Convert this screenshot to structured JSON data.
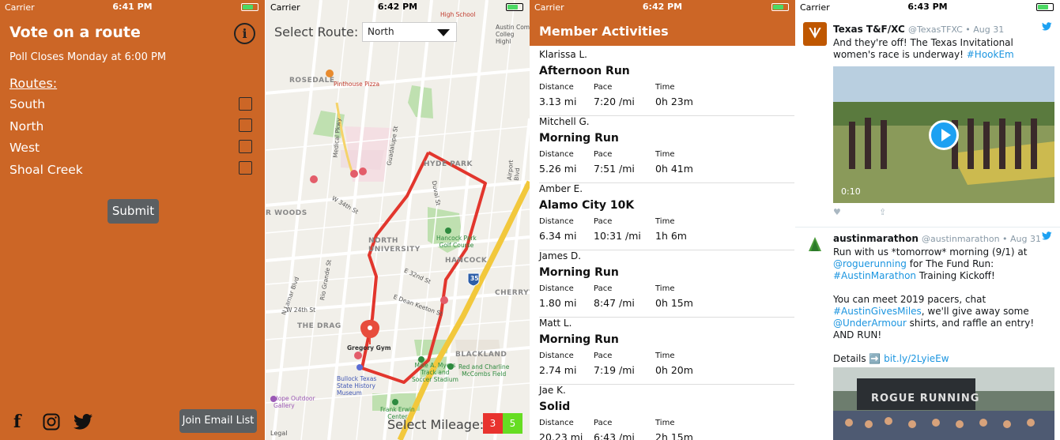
{
  "screens": {
    "vote": {
      "status": {
        "carrier": "Carrier",
        "time": "6:41 PM"
      },
      "title": "Vote on a route",
      "info_icon": "info-icon",
      "poll": "Poll Closes Monday at 6:00 PM",
      "routes_heading": "Routes:",
      "routes": [
        "South",
        "North",
        "West",
        "Shoal Creek"
      ],
      "submit": "Submit",
      "join": "Join Email List",
      "social": [
        "facebook-icon",
        "instagram-icon",
        "twitter-icon"
      ]
    },
    "map": {
      "status": {
        "carrier": "Carrier",
        "time": "6:42 PM"
      },
      "select_route_label": "Select Route:",
      "selected_route": "North",
      "select_mileage_label": "Select Mileage:",
      "mileage_options": [
        {
          "label": "3",
          "color": "#e8332e"
        },
        {
          "label": "5",
          "color": "#66dd22"
        }
      ],
      "labels": {
        "high_school": "High School",
        "pinthouse": "Pinthouse Pizza",
        "rosedale": "ROSEDALE",
        "hyde_park": "HYDE PARK",
        "hancock": "HANCOCK",
        "north_univ": "NORTH\nUNIVERSITY",
        "the_drag": "THE DRAG",
        "blackland": "BLACKLAND",
        "cherrywood": "CHERRYWOOD",
        "oak_woods": "R WOODS",
        "gregory_gym": "Gregory Gym",
        "hancock_golf": "Hancock Park\nGolf Course",
        "bullock": "Bullock Texas\nState History\nMuseum",
        "mike_myers": "Mike A. Myers\nTrack and\nSoccer Stadium",
        "red_charline": "Red and Charline\nMcCombs Field",
        "frank_erwin": "Frank Erwin\nCenter",
        "hope_outdoor": "Hope Outdoor\nGallery",
        "austin_comm": "Austin Comm\nColleg\nHighl",
        "e_dean": "E Dean Keeton St",
        "e_32nd": "E 32nd St",
        "w_34th": "W 34th St",
        "w_24th": "W 24th St",
        "duval": "Duval St",
        "guadalupe": "Guadalupe St",
        "medical": "Medical Pkwy",
        "airport": "Airport Blvd",
        "rio_grande": "Rio Grande St",
        "lamar": "N Lamar Blvd",
        "i35": "35",
        "legal": "Legal"
      }
    },
    "activities": {
      "status": {
        "carrier": "Carrier",
        "time": "6:42 PM"
      },
      "header": "Member Activities",
      "col_labels": {
        "distance": "Distance",
        "pace": "Pace",
        "time": "Time"
      },
      "items": [
        {
          "who": "Klarissa L.",
          "title": "Afternoon Run",
          "distance": "3.13 mi",
          "pace": "7:20 /mi",
          "time": "0h 23m"
        },
        {
          "who": "Mitchell G.",
          "title": "Morning Run",
          "distance": "5.26 mi",
          "pace": "7:51 /mi",
          "time": "0h 41m"
        },
        {
          "who": "Amber E.",
          "title": "Alamo City 10K",
          "distance": "6.34 mi",
          "pace": "10:31 /mi",
          "time": "1h 6m"
        },
        {
          "who": "James D.",
          "title": "Morning Run",
          "distance": "1.80 mi",
          "pace": "8:47 /mi",
          "time": "0h 15m"
        },
        {
          "who": "Matt L.",
          "title": "Morning Run",
          "distance": "2.74 mi",
          "pace": "7:19 /mi",
          "time": "0h 20m"
        },
        {
          "who": "Jae K.",
          "title": "Solid",
          "distance": "20.23 mi",
          "pace": "6:43 /mi",
          "time": "2h 15m"
        }
      ]
    },
    "twitter": {
      "status": {
        "carrier": "Carrier",
        "time": "6:43 PM"
      },
      "tweet1": {
        "name": "Texas T&F/XC",
        "handle": "@TexasTFXC • Aug 31",
        "text": "And they're off! The Texas Invitational women's race is underway! ",
        "hashtag": "#HookEm",
        "video_time": "0:10"
      },
      "tweet2": {
        "name": "austinmarathon",
        "handle": "@austinmarathon • Aug 31",
        "line1": "Run with us *tomorrow* morning (9/1) at",
        "mention1": "@roguerunning",
        "line2": " for The Fund Run:",
        "hashtag1": "#AustinMarathon",
        "line3": " Training Kickoff!",
        "line4": "You can meet 2019 pacers, chat",
        "hashtag2": "#AustinGivesMiles",
        "line5": ", we'll give away some",
        "mention2": "@UnderArmour",
        "line6": " shirts, and raffle an entry! AND RUN!",
        "details": "Details ➡️ ",
        "link": "bit.ly/2LyieEw",
        "photo_text": "ROGUE RUNNING"
      }
    }
  }
}
